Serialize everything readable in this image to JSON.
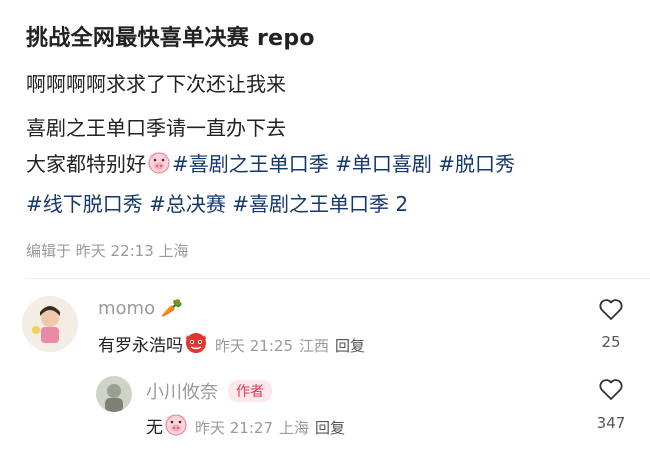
{
  "post": {
    "title": "挑战全网最快喜单决赛 repo",
    "line1": "啊啊啊啊求求了下次还让我来",
    "line2": "喜剧之王单口季请一直办下去",
    "line3_text": "大家都特别好",
    "line3_tags": [
      "#喜剧之王单口季",
      "#单口喜剧",
      "#脱口秀"
    ],
    "line4_tags": [
      "#线下脱口秀",
      "#总决赛",
      "#喜剧之王单口季 2"
    ],
    "meta": "编辑于  昨天 22:13 上海"
  },
  "comments": [
    {
      "username": "momo",
      "username_emoji": "🥕",
      "text": "有罗永浩吗",
      "text_emoji": "devil-face-icon",
      "time": "昨天 21:25",
      "location": "江西",
      "reply_label": "回复",
      "likes": "25"
    },
    {
      "username": "小川攸奈",
      "badge": "作者",
      "text": "无",
      "text_emoji": "pig-face-icon",
      "time": "昨天 21:27",
      "location": "上海",
      "reply_label": "回复",
      "likes": "347"
    }
  ],
  "colors": {
    "hashtag": "#13386c",
    "badge_bg": "#fde8ec",
    "badge_text": "#e0385c",
    "meta": "#9a9a9a"
  }
}
